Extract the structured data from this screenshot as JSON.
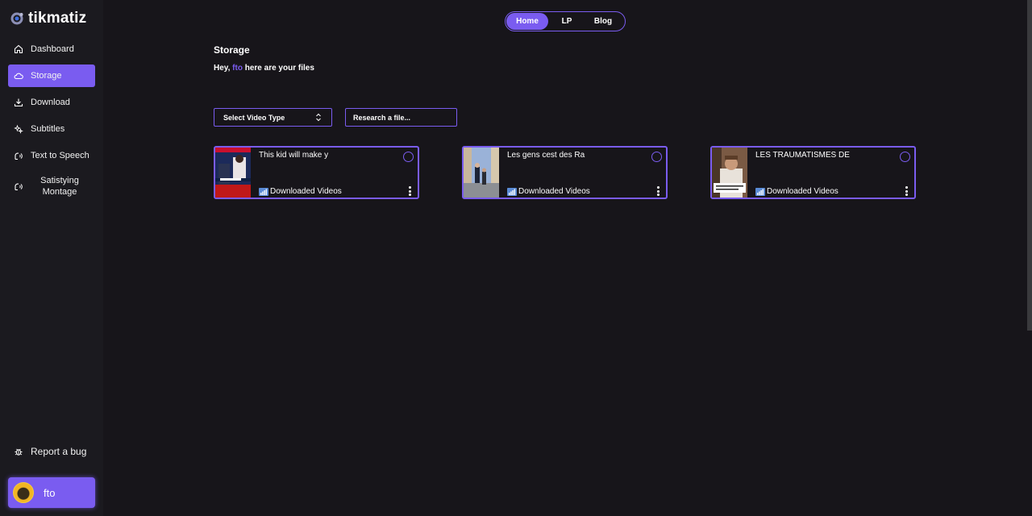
{
  "app": {
    "name": "tikmatiz",
    "accent": "#7a5cf0",
    "background": "#17151a"
  },
  "sidebar": {
    "items": [
      {
        "label": "Dashboard",
        "icon": "home-icon"
      },
      {
        "label": "Storage",
        "icon": "cloud-icon",
        "active": true
      },
      {
        "label": "Download",
        "icon": "download-icon"
      },
      {
        "label": "Subtitles",
        "icon": "sparkle-icon"
      },
      {
        "label": "Text to Speech",
        "icon": "speech-icon"
      },
      {
        "label": "Satistying Montage",
        "icon": "speech-icon"
      }
    ],
    "report_label": "Report a bug",
    "user_name": "fto"
  },
  "topnav": {
    "home": "Home",
    "lp": "LP",
    "blog": "Blog"
  },
  "main": {
    "title": "Storage",
    "greeting_prefix": "Hey,",
    "greeting_user": "fto",
    "greeting_suffix": "here are your files",
    "select_label": "Select Video Type",
    "search_placeholder": "Research a file..."
  },
  "files": [
    {
      "title": "This kid will make y",
      "folder": "Downloaded Videos"
    },
    {
      "title": "Les gens cest des Ra",
      "folder": "Downloaded Videos"
    },
    {
      "title": "LES TRAUMATISMES DE",
      "folder": "Downloaded Videos"
    }
  ]
}
